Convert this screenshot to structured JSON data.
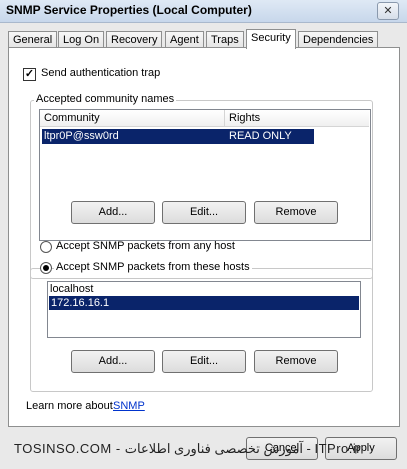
{
  "window": {
    "title": "SNMP Service Properties (Local Computer)",
    "close_glyph": "✕"
  },
  "tabs": [
    {
      "label": "General"
    },
    {
      "label": "Log On"
    },
    {
      "label": "Recovery"
    },
    {
      "label": "Agent"
    },
    {
      "label": "Traps"
    },
    {
      "label": "Security",
      "active": true
    },
    {
      "label": "Dependencies"
    }
  ],
  "security": {
    "send_auth_trap": {
      "label": "Send authentication trap",
      "checked": true,
      "mark": "✓"
    },
    "communities": {
      "group_title": "Accepted community names",
      "headers": {
        "community": "Community",
        "rights": "Rights"
      },
      "rows": [
        {
          "community": "ltpr0P@ssw0rd",
          "rights": "READ ONLY",
          "selected": true
        }
      ],
      "buttons": {
        "add": "Add...",
        "edit": "Edit...",
        "remove": "Remove"
      }
    },
    "accept_any": {
      "label": "Accept SNMP packets from any host",
      "selected": false
    },
    "accept_these": {
      "label": "Accept SNMP packets from these hosts",
      "selected": true
    },
    "hosts": {
      "items": [
        {
          "name": "localhost",
          "selected": false
        },
        {
          "name": "172.16.16.1",
          "selected": true
        }
      ],
      "buttons": {
        "add": "Add...",
        "edit": "Edit...",
        "remove": "Remove"
      }
    },
    "learn_more": {
      "prefix": "Learn more about",
      "link": "SNMP"
    }
  },
  "footer": {
    "watermark": "TOSINSO.COM - آموزش تخصصی فناوری اطلاعات - ITPro.ir",
    "cancel": "Cancel",
    "apply": "Apply"
  },
  "colors": {
    "selection": "#0a246a",
    "link": "#0033cc"
  }
}
